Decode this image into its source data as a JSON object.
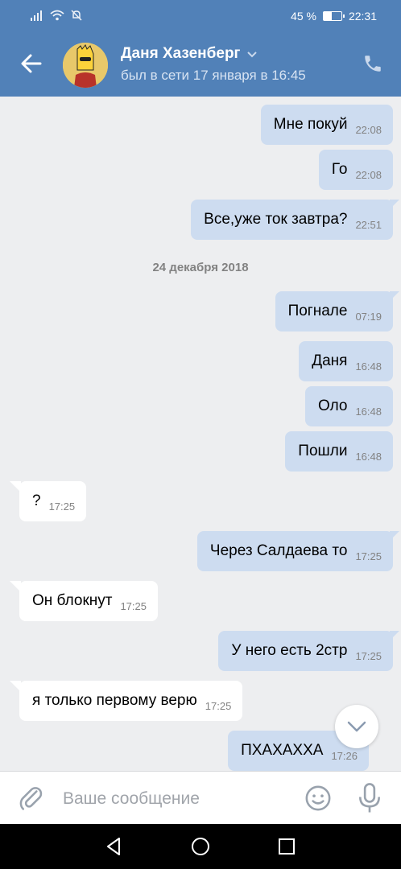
{
  "status_bar": {
    "battery_percent": "45 %",
    "battery_level": 0.45,
    "time": "22:31"
  },
  "header": {
    "name": "Даня Хазенберг",
    "status": "был в сети 17 января в 16:45"
  },
  "date_separator": "24 декабря 2018",
  "messages": [
    {
      "dir": "out",
      "text": "Мне покуй",
      "time": "22:08"
    },
    {
      "dir": "out",
      "text": "Го",
      "time": "22:08"
    },
    {
      "dir": "out",
      "text": "Все,уже ток завтра?",
      "time": "22:51"
    },
    {
      "dir": "out",
      "text": "Погнале",
      "time": "07:19"
    },
    {
      "dir": "out",
      "text": "Даня",
      "time": "16:48"
    },
    {
      "dir": "out",
      "text": "Оло",
      "time": "16:48"
    },
    {
      "dir": "out",
      "text": "Пошли",
      "time": "16:48"
    },
    {
      "dir": "in",
      "text": "?",
      "time": "17:25"
    },
    {
      "dir": "out",
      "text": "Через Салдаева то",
      "time": "17:25"
    },
    {
      "dir": "in",
      "text": "Он блокнут",
      "time": "17:25"
    },
    {
      "dir": "out",
      "text": "У него есть 2стр",
      "time": "17:25"
    },
    {
      "dir": "in",
      "text": "я только первому верю",
      "time": "17:25"
    },
    {
      "dir": "out",
      "text": "ПХАХАХХА",
      "time": "17:26"
    }
  ],
  "input": {
    "placeholder": "Ваше сообщение",
    "value": ""
  },
  "colors": {
    "header": "#5181b8",
    "outgoing": "#cddcf0",
    "incoming": "#ffffff",
    "background": "#edeef0"
  }
}
